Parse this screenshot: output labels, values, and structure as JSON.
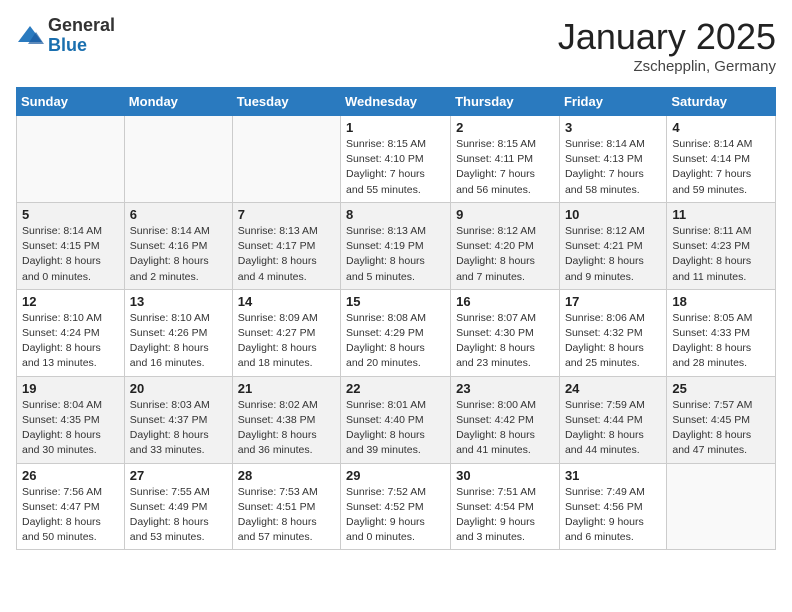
{
  "logo": {
    "general": "General",
    "blue": "Blue"
  },
  "title": "January 2025",
  "location": "Zschepplin, Germany",
  "days_of_week": [
    "Sunday",
    "Monday",
    "Tuesday",
    "Wednesday",
    "Thursday",
    "Friday",
    "Saturday"
  ],
  "weeks": [
    [
      {
        "day": "",
        "info": ""
      },
      {
        "day": "",
        "info": ""
      },
      {
        "day": "",
        "info": ""
      },
      {
        "day": "1",
        "info": "Sunrise: 8:15 AM\nSunset: 4:10 PM\nDaylight: 7 hours\nand 55 minutes."
      },
      {
        "day": "2",
        "info": "Sunrise: 8:15 AM\nSunset: 4:11 PM\nDaylight: 7 hours\nand 56 minutes."
      },
      {
        "day": "3",
        "info": "Sunrise: 8:14 AM\nSunset: 4:13 PM\nDaylight: 7 hours\nand 58 minutes."
      },
      {
        "day": "4",
        "info": "Sunrise: 8:14 AM\nSunset: 4:14 PM\nDaylight: 7 hours\nand 59 minutes."
      }
    ],
    [
      {
        "day": "5",
        "info": "Sunrise: 8:14 AM\nSunset: 4:15 PM\nDaylight: 8 hours\nand 0 minutes."
      },
      {
        "day": "6",
        "info": "Sunrise: 8:14 AM\nSunset: 4:16 PM\nDaylight: 8 hours\nand 2 minutes."
      },
      {
        "day": "7",
        "info": "Sunrise: 8:13 AM\nSunset: 4:17 PM\nDaylight: 8 hours\nand 4 minutes."
      },
      {
        "day": "8",
        "info": "Sunrise: 8:13 AM\nSunset: 4:19 PM\nDaylight: 8 hours\nand 5 minutes."
      },
      {
        "day": "9",
        "info": "Sunrise: 8:12 AM\nSunset: 4:20 PM\nDaylight: 8 hours\nand 7 minutes."
      },
      {
        "day": "10",
        "info": "Sunrise: 8:12 AM\nSunset: 4:21 PM\nDaylight: 8 hours\nand 9 minutes."
      },
      {
        "day": "11",
        "info": "Sunrise: 8:11 AM\nSunset: 4:23 PM\nDaylight: 8 hours\nand 11 minutes."
      }
    ],
    [
      {
        "day": "12",
        "info": "Sunrise: 8:10 AM\nSunset: 4:24 PM\nDaylight: 8 hours\nand 13 minutes."
      },
      {
        "day": "13",
        "info": "Sunrise: 8:10 AM\nSunset: 4:26 PM\nDaylight: 8 hours\nand 16 minutes."
      },
      {
        "day": "14",
        "info": "Sunrise: 8:09 AM\nSunset: 4:27 PM\nDaylight: 8 hours\nand 18 minutes."
      },
      {
        "day": "15",
        "info": "Sunrise: 8:08 AM\nSunset: 4:29 PM\nDaylight: 8 hours\nand 20 minutes."
      },
      {
        "day": "16",
        "info": "Sunrise: 8:07 AM\nSunset: 4:30 PM\nDaylight: 8 hours\nand 23 minutes."
      },
      {
        "day": "17",
        "info": "Sunrise: 8:06 AM\nSunset: 4:32 PM\nDaylight: 8 hours\nand 25 minutes."
      },
      {
        "day": "18",
        "info": "Sunrise: 8:05 AM\nSunset: 4:33 PM\nDaylight: 8 hours\nand 28 minutes."
      }
    ],
    [
      {
        "day": "19",
        "info": "Sunrise: 8:04 AM\nSunset: 4:35 PM\nDaylight: 8 hours\nand 30 minutes."
      },
      {
        "day": "20",
        "info": "Sunrise: 8:03 AM\nSunset: 4:37 PM\nDaylight: 8 hours\nand 33 minutes."
      },
      {
        "day": "21",
        "info": "Sunrise: 8:02 AM\nSunset: 4:38 PM\nDaylight: 8 hours\nand 36 minutes."
      },
      {
        "day": "22",
        "info": "Sunrise: 8:01 AM\nSunset: 4:40 PM\nDaylight: 8 hours\nand 39 minutes."
      },
      {
        "day": "23",
        "info": "Sunrise: 8:00 AM\nSunset: 4:42 PM\nDaylight: 8 hours\nand 41 minutes."
      },
      {
        "day": "24",
        "info": "Sunrise: 7:59 AM\nSunset: 4:44 PM\nDaylight: 8 hours\nand 44 minutes."
      },
      {
        "day": "25",
        "info": "Sunrise: 7:57 AM\nSunset: 4:45 PM\nDaylight: 8 hours\nand 47 minutes."
      }
    ],
    [
      {
        "day": "26",
        "info": "Sunrise: 7:56 AM\nSunset: 4:47 PM\nDaylight: 8 hours\nand 50 minutes."
      },
      {
        "day": "27",
        "info": "Sunrise: 7:55 AM\nSunset: 4:49 PM\nDaylight: 8 hours\nand 53 minutes."
      },
      {
        "day": "28",
        "info": "Sunrise: 7:53 AM\nSunset: 4:51 PM\nDaylight: 8 hours\nand 57 minutes."
      },
      {
        "day": "29",
        "info": "Sunrise: 7:52 AM\nSunset: 4:52 PM\nDaylight: 9 hours\nand 0 minutes."
      },
      {
        "day": "30",
        "info": "Sunrise: 7:51 AM\nSunset: 4:54 PM\nDaylight: 9 hours\nand 3 minutes."
      },
      {
        "day": "31",
        "info": "Sunrise: 7:49 AM\nSunset: 4:56 PM\nDaylight: 9 hours\nand 6 minutes."
      },
      {
        "day": "",
        "info": ""
      }
    ]
  ]
}
